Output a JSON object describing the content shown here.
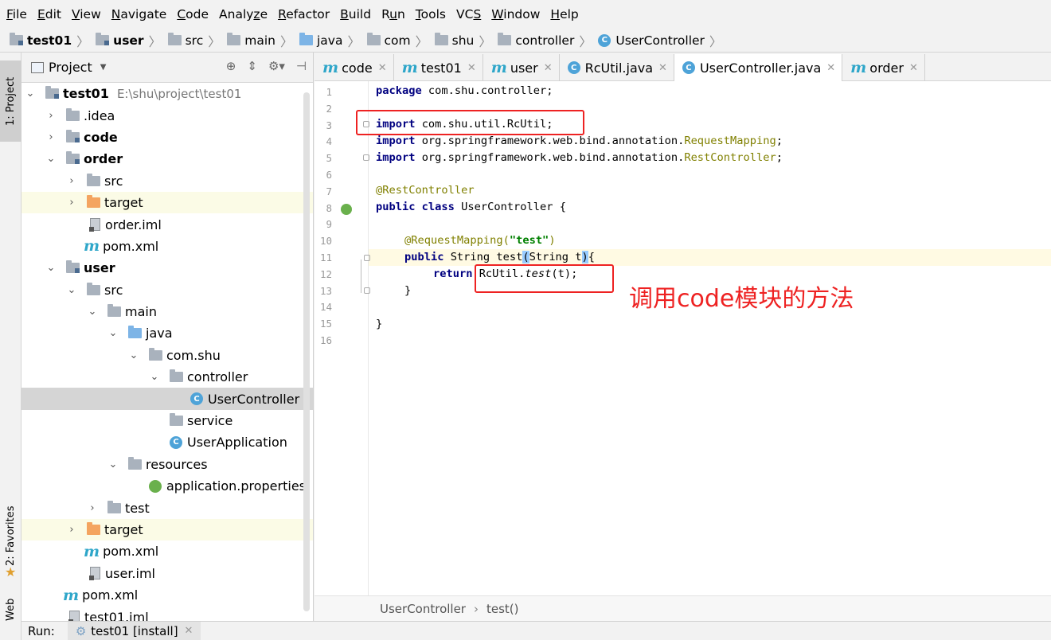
{
  "menu": [
    {
      "label": "File",
      "u": "F"
    },
    {
      "label": "Edit",
      "u": "E"
    },
    {
      "label": "View",
      "u": "V"
    },
    {
      "label": "Navigate",
      "u": "N"
    },
    {
      "label": "Code",
      "u": "C"
    },
    {
      "label": "Analyze",
      "u": "z"
    },
    {
      "label": "Refactor",
      "u": "R"
    },
    {
      "label": "Build",
      "u": "B"
    },
    {
      "label": "Run",
      "u": "u"
    },
    {
      "label": "Tools",
      "u": "T"
    },
    {
      "label": "VCS",
      "u": "S"
    },
    {
      "label": "Window",
      "u": "W"
    },
    {
      "label": "Help",
      "u": "H"
    }
  ],
  "breadcrumb": [
    "test01",
    "user",
    "src",
    "main",
    "java",
    "com",
    "shu",
    "controller",
    "UserController"
  ],
  "project": {
    "title": "Project",
    "tree": [
      {
        "label": "test01",
        "extra": "E:\\shu\\project\\test01"
      },
      {
        "label": ".idea"
      },
      {
        "label": "code"
      },
      {
        "label": "order"
      },
      {
        "label": "src"
      },
      {
        "label": "target"
      },
      {
        "label": "order.iml"
      },
      {
        "label": "pom.xml"
      },
      {
        "label": "user"
      },
      {
        "label": "src"
      },
      {
        "label": "main"
      },
      {
        "label": "java"
      },
      {
        "label": "com.shu"
      },
      {
        "label": "controller"
      },
      {
        "label": "UserController"
      },
      {
        "label": "service"
      },
      {
        "label": "UserApplication"
      },
      {
        "label": "resources"
      },
      {
        "label": "application.properties"
      },
      {
        "label": "test"
      },
      {
        "label": "target"
      },
      {
        "label": "pom.xml"
      },
      {
        "label": "user.iml"
      },
      {
        "label": "pom.xml"
      },
      {
        "label": "test01.iml"
      }
    ]
  },
  "tabs": [
    "code",
    "test01",
    "user",
    "RcUtil.java",
    "UserController.java",
    "order"
  ],
  "code": {
    "line_numbers": [
      "1",
      "2",
      "3",
      "4",
      "5",
      "6",
      "7",
      "8",
      "9",
      "10",
      "11",
      "12",
      "13",
      "14",
      "15",
      "16"
    ],
    "l1_kw": "package",
    "l1_rest": " com.shu.controller;",
    "l3_kw": "import",
    "l3_rest": " com.shu.util.RcUtil;",
    "l4_kw": "import",
    "l4_rest": " org.springframework.web.bind.annotation.",
    "l4_ann": "RequestMapping",
    "l4_end": ";",
    "l5_kw": "import",
    "l5_rest": " org.springframework.web.bind.annotation.",
    "l5_ann": "RestController",
    "l5_end": ";",
    "l7_ann": "@RestController",
    "l8_kw": "public class",
    "l8_rest": " UserController {",
    "l10_ann": "@RequestMapping(",
    "l10_str": "\"test\"",
    "l10_end": ")",
    "l11_kw": "public",
    "l11_mid": " String test",
    "l11_p1": "(",
    "l11_args": "String t",
    "l11_p2": ")",
    "l11_end": "{",
    "l12_kw": "return",
    "l12_cls": " RcUtil.",
    "l12_it": "test",
    "l12_end": "(t);",
    "l13": "}",
    "l15": "}"
  },
  "annotation_note": "调用code模块的方法",
  "editor_status": {
    "class": "UserController",
    "method": "test()"
  },
  "side_tabs": {
    "project": "1: Project",
    "favorites": "2: Favorites",
    "web": "Web"
  },
  "run": {
    "label": "Run:",
    "tab": "test01 [install]"
  }
}
